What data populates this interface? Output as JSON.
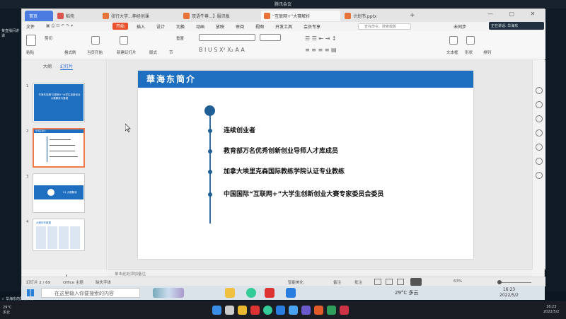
{
  "meeting": {
    "title": "腾讯会议",
    "user_name_top": "某直播间讲课",
    "speaker_label": "☆ 华海东的屏幕共享"
  },
  "tabs": [
    {
      "label": "首页"
    },
    {
      "label": "稻壳"
    },
    {
      "label": "张行大学...神经创课"
    },
    {
      "label": "双语牛尊...】服讯板"
    },
    {
      "label": "“互联网+”大赛解析"
    },
    {
      "label": "计划书.pptx"
    },
    {
      "label": "+"
    }
  ],
  "meeting_bubble": "正在讲话: 华海东",
  "menus": [
    "文件",
    "开始",
    "插入",
    "设计",
    "切换",
    "动画",
    "放映",
    "审阅",
    "视图",
    "开发工具",
    "会员专享"
  ],
  "search_placeholder": "查找命令、搜索模板",
  "sync_label": "未同步",
  "ribbon": {
    "paste": "粘贴",
    "cut": "剪切",
    "format_painter": "格式刷",
    "from_current": "当页开始",
    "new_slide": "新建幻灯片",
    "layout": "版式",
    "section": "节",
    "reset": "重置",
    "textbox": "文本框",
    "shape": "形状",
    "arrange": "排列"
  },
  "panel_tabs": {
    "outline": "大纲",
    "slides": "幻灯片"
  },
  "thumbnails": [
    {
      "num": "1",
      "title": "华海东讲解“互联网+”大学生创新创业大赛解析与备赛"
    },
    {
      "num": "2",
      "title": "华海东简介"
    },
    {
      "num": "3",
      "title": "01 大赛解读",
      "badge": "01"
    },
    {
      "num": "4",
      "title": "大赛历年数据"
    }
  ],
  "slide": {
    "title": "華海东简介",
    "items": [
      "连续创业者",
      "教育部万名优秀创新创业导师人才库成员",
      "加拿大埃里克森国际教练学院认证专业教练",
      "中国国际“互联网+”大学生创新创业大赛专家委员会委员"
    ]
  },
  "notes_placeholder": "单击此处添加备注",
  "status": {
    "slide_counter": "幻灯片 2 / 69",
    "theme": "Office 主题",
    "missing_font": "缺失字体",
    "beautify": "智能美化",
    "notes": "备注",
    "comments": "批注",
    "zoom": "63%"
  },
  "taskbar_inner": {
    "search_placeholder": "在这里输入你要搜索的内容",
    "weather": "29°C 多云",
    "time": "16:23",
    "date": "2022/5/2"
  },
  "taskbar_outer": {
    "temp": "29°C",
    "weather": "多云",
    "time": "16:23",
    "date": "2022/5/2"
  },
  "colors": {
    "accent_blue": "#1f6fc0",
    "timeline": "#1f5f96",
    "start_tab": "#e9522c",
    "home_tab": "#4b7be0"
  }
}
